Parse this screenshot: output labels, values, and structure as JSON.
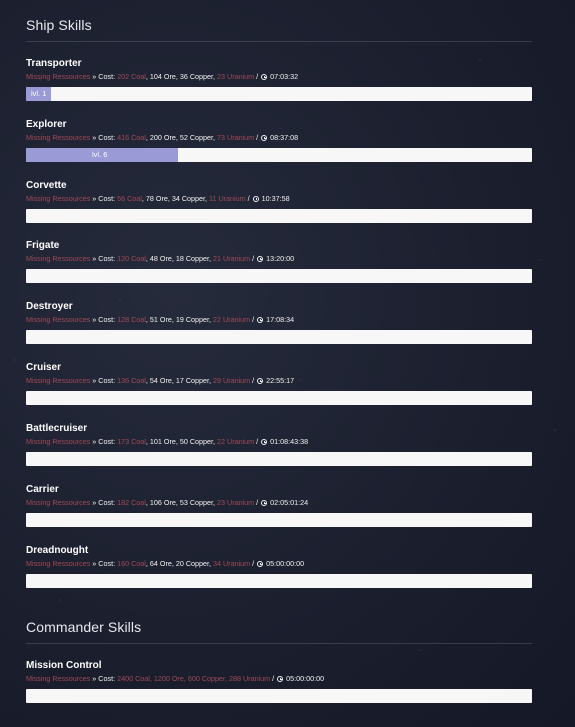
{
  "ship_skills": {
    "title": "Ship Skills",
    "skills": [
      {
        "name": "Transporter",
        "missing": "Missing Ressources",
        "sep": " » Cost: ",
        "coal": "202 Coal",
        "ore": "104 Ore",
        "copper": "36 Copper",
        "uranium": "23 Uranium",
        "time": "07:03:32",
        "level_label": "lvl. 1",
        "progress": 0.05
      },
      {
        "name": "Explorer",
        "missing": "Missing Ressources",
        "sep": " » Cost: ",
        "coal": "416 Coal",
        "ore": "200 Ore",
        "copper": "52 Copper",
        "uranium": "73 Uranium",
        "time": "08:37:08",
        "level_label": "lvl. 6",
        "progress": 0.3
      },
      {
        "name": "Corvette",
        "missing": "Missing Ressources",
        "sep": " » Cost: ",
        "coal": "56 Coal",
        "ore": "78 Ore",
        "copper": "34 Copper",
        "uranium": "11 Uranium",
        "time": "10:37:58",
        "level_label": "",
        "progress": 0
      },
      {
        "name": "Frigate",
        "missing": "Missing Ressources",
        "sep": " » Cost: ",
        "coal": "120 Coal",
        "ore": "48 Ore",
        "copper": "18 Copper",
        "uranium": "21 Uranium",
        "time": "13:20:00",
        "level_label": "",
        "progress": 0
      },
      {
        "name": "Destroyer",
        "missing": "Missing Ressources",
        "sep": " » Cost: ",
        "coal": "128 Coal",
        "ore": "51 Ore",
        "copper": "19 Copper",
        "uranium": "22 Uranium",
        "time": "17:08:34",
        "level_label": "",
        "progress": 0
      },
      {
        "name": "Cruiser",
        "missing": "Missing Ressources",
        "sep": " » Cost: ",
        "coal": "136 Coal",
        "ore": "54 Ore",
        "copper": "17 Copper",
        "uranium": "29 Uranium",
        "time": "22:55:17",
        "level_label": "",
        "progress": 0
      },
      {
        "name": "Battlecruiser",
        "missing": "Missing Ressources",
        "sep": " » Cost: ",
        "coal": "173 Coal",
        "ore": "101 Ore",
        "copper": "50 Copper",
        "uranium": "22 Uranium",
        "time": "01:08:43:38",
        "level_label": "",
        "progress": 0
      },
      {
        "name": "Carrier",
        "missing": "Missing Ressources",
        "sep": " » Cost: ",
        "coal": "182 Coal",
        "ore": "106 Ore",
        "copper": "53 Copper",
        "uranium": "23 Uranium",
        "time": "02:05:01:24",
        "level_label": "",
        "progress": 0
      },
      {
        "name": "Dreadnought",
        "missing": "Missing Ressources",
        "sep": " » Cost: ",
        "coal": "160 Coal",
        "ore": "64 Ore",
        "copper": "20 Copper",
        "uranium": "34 Uranium",
        "time": "05:00:00:00",
        "level_label": "",
        "progress": 0
      }
    ]
  },
  "commander_skills": {
    "title": "Commander Skills",
    "skills": [
      {
        "name": "Mission Control",
        "missing": "Missing Ressources",
        "sep": " » Cost: ",
        "coal": "2400 Coal",
        "ore": "1200 Ore",
        "copper": "600 Copper",
        "uranium": "288 Uranium",
        "time": "05:00:00:00",
        "level_label": "",
        "progress": 0
      }
    ]
  },
  "colors": {
    "missing": "#a04a56",
    "progress_fill": "#9a9ad6",
    "progress_track": "#f7f7f8"
  },
  "icons": {
    "time": "clock-icon"
  }
}
